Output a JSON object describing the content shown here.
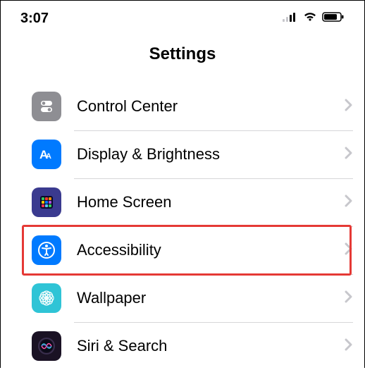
{
  "statusbar": {
    "time": "3:07"
  },
  "header": {
    "title": "Settings"
  },
  "rows": {
    "control_center": "Control Center",
    "display_brightness": "Display & Brightness",
    "home_screen": "Home Screen",
    "accessibility": "Accessibility",
    "wallpaper": "Wallpaper",
    "siri_search": "Siri & Search"
  }
}
